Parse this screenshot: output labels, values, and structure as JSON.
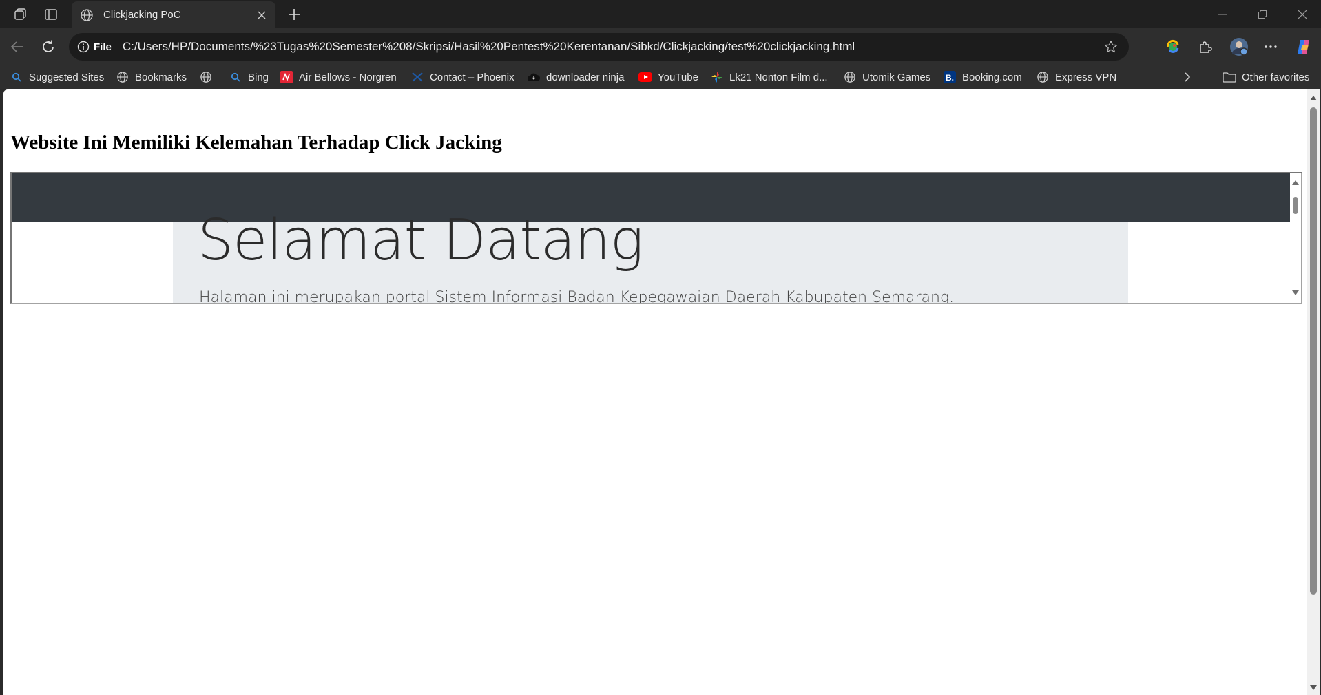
{
  "tab": {
    "title": "Clickjacking PoC"
  },
  "address": {
    "scheme_label": "File",
    "url": "C:/Users/HP/Documents/%23Tugas%20Semester%208/Skripsi/Hasil%20Pentest%20Kerentanan/Sibkd/Clickjacking/test%20clickjacking.html"
  },
  "favorites": {
    "items": [
      {
        "label": "Suggested Sites",
        "icon": "search-icon"
      },
      {
        "label": "Bookmarks",
        "icon": "globe-icon"
      },
      {
        "label": "",
        "icon": "globe-icon"
      },
      {
        "label": "Bing",
        "icon": "search-icon"
      },
      {
        "label": "Air Bellows - Norgren",
        "icon": "norgren-icon"
      },
      {
        "label": "Contact – Phoenix",
        "icon": "phoenix-icon"
      },
      {
        "label": "downloader ninja",
        "icon": "cloud-icon"
      },
      {
        "label": "YouTube",
        "icon": "youtube-icon"
      },
      {
        "label": "Lk21 Nonton Film d...",
        "icon": "lk21-icon"
      },
      {
        "label": "Utomik Games",
        "icon": "globe-icon"
      },
      {
        "label": "Booking.com",
        "icon": "booking-icon"
      },
      {
        "label": "Express VPN",
        "icon": "globe-icon"
      }
    ],
    "other_favorites": "Other favorites"
  },
  "page": {
    "heading": "Website Ini Memiliki Kelemahan Terhadap Click Jacking",
    "iframe": {
      "title": "Selamat Datang",
      "lead": "Halaman ini merupakan portal Sistem Informasi Badan Kepegawaian Daerah Kabupaten Semarang."
    }
  },
  "colors": {
    "iframe_navbar": "#343a40",
    "iframe_jumbotron": "#e9ecef",
    "chrome_dark": "#202020"
  }
}
